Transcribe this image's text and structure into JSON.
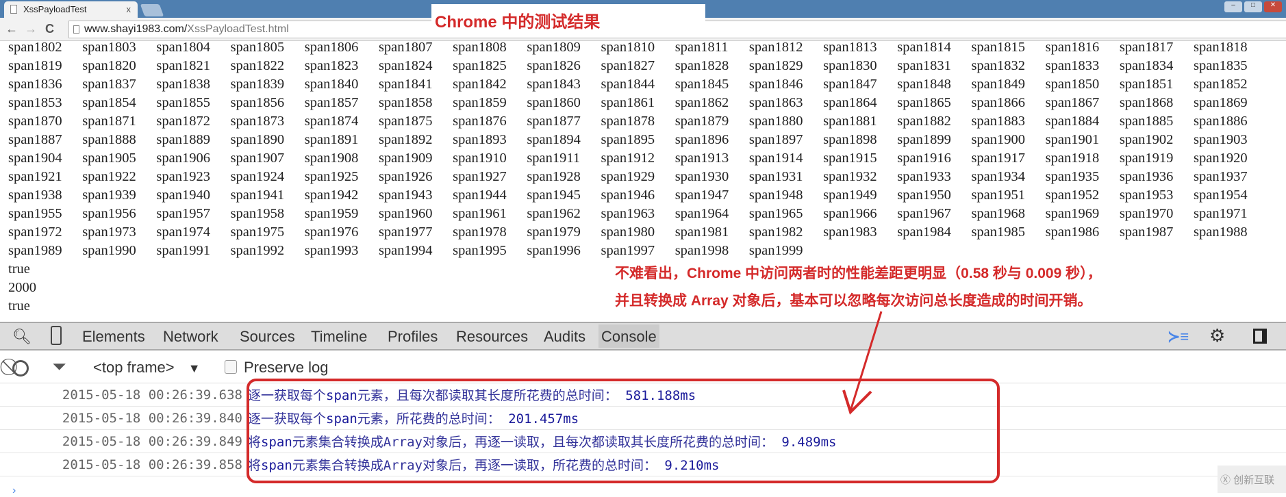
{
  "browser": {
    "tab_title": "XssPayloadTest",
    "tab_close": "x",
    "url_host": "www.shayi1983.com/",
    "url_path": "XssPayloadTest.html",
    "back": "←",
    "forward": "→",
    "reload": "C"
  },
  "overlay_title": "Chrome 中的测试结果",
  "page": {
    "span_prefix": "span",
    "span_start": 1802,
    "span_end": 1999,
    "lines": [
      "true",
      "2000",
      "true"
    ]
  },
  "annotation": {
    "line1": "不难看出，Chrome 中访问两者时的性能差距更明显（0.58 秒与 0.009 秒），",
    "line2": "并且转换成 Array 对象后，基本可以忽略每次访问总长度造成的时间开销。",
    "color": "#d42a2a"
  },
  "devtools": {
    "tabs": [
      "Elements",
      "Network",
      "Sources",
      "Timeline",
      "Profiles",
      "Resources",
      "Audits",
      "Console"
    ],
    "active_tab": "Console",
    "frame_select": "<top frame>",
    "preserve_log": "Preserve log",
    "preserve_log_checked": false
  },
  "console": [
    {
      "time": "2015-05-18 00:26:39.638",
      "pre": "逐一获取每个",
      "kw": "span",
      "post": "元素，且每次都读取其长度所花费的总时间：",
      "val": " 581.188ms"
    },
    {
      "time": "2015-05-18 00:26:39.840",
      "pre": "逐一获取每个",
      "kw": "span",
      "post": "元素，所花费的总时间：",
      "val": " 201.457ms"
    },
    {
      "time": "2015-05-18 00:26:39.849",
      "pre": "将",
      "kw": "span",
      "post": "元素集合转换成Array对象后，再逐一读取，且每次都读取其长度所花费的总时间：",
      "val": " 9.489ms"
    },
    {
      "time": "2015-05-18 00:26:39.858",
      "pre": "将",
      "kw": "span",
      "post": "元素集合转换成Array对象后，再逐一读取，所花费的总时间：",
      "val": " 9.210ms"
    }
  ],
  "watermark": "创新互联"
}
